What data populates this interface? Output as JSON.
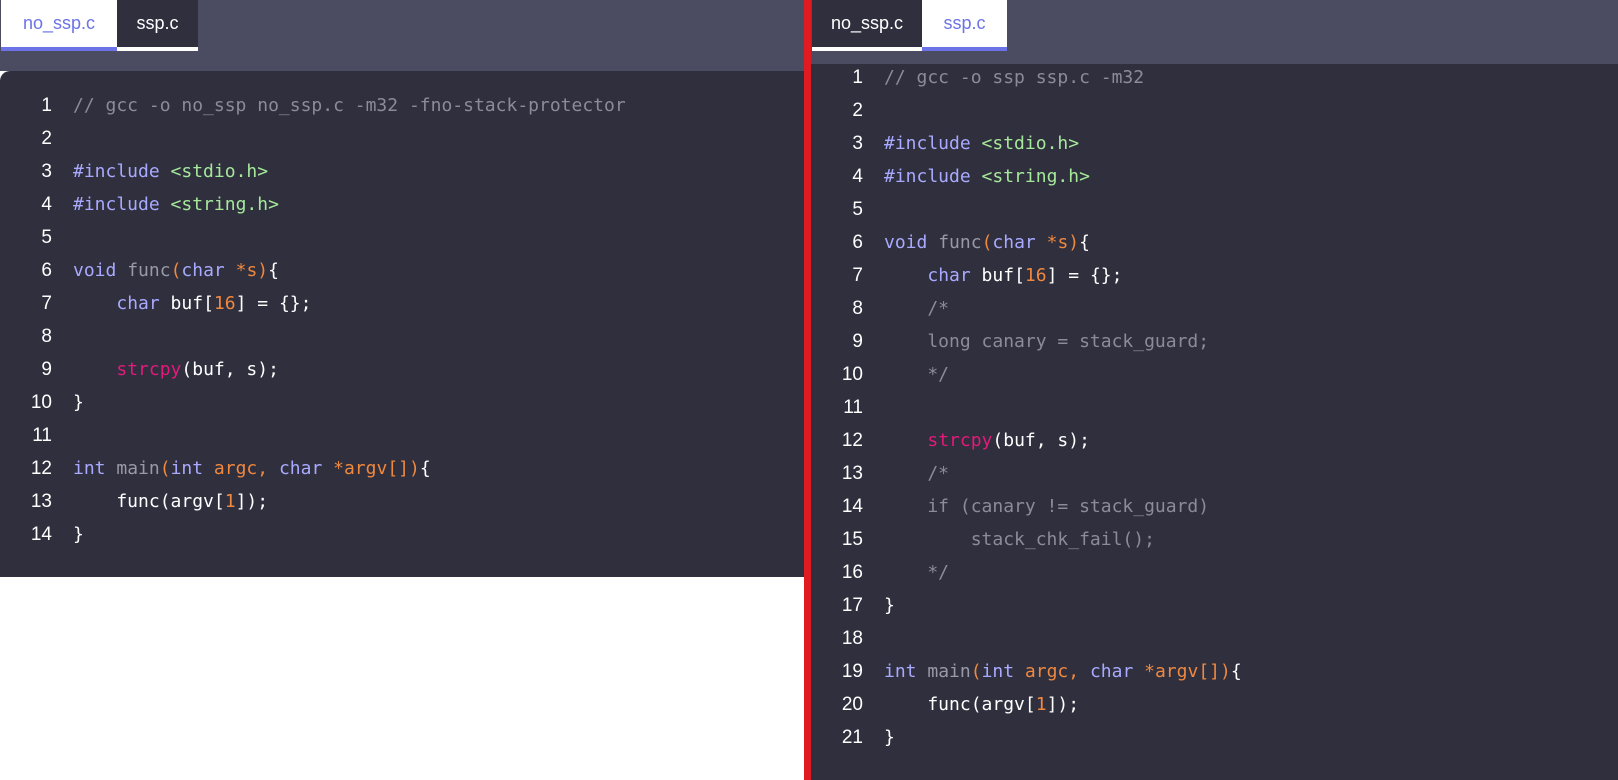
{
  "colors": {
    "tab_bar": "#4b4b62",
    "code_bg": "#2f2f3e",
    "active_tab_accent": "#6b73e6",
    "divider": "#e11b22",
    "comment": "#8c8c98",
    "keyword": "#a9aaff",
    "string": "#a6e89a",
    "number": "#f0883e",
    "call": "#e21a7a"
  },
  "left_pane": {
    "tabs": [
      {
        "label": "no_ssp.c",
        "active": true
      },
      {
        "label": "ssp.c",
        "active": false
      }
    ],
    "lines": [
      {
        "n": "1",
        "tokens": [
          [
            "// gcc -o no_ssp no_ssp.c -m32 -fno-stack-protector",
            "comment"
          ]
        ]
      },
      {
        "n": "2",
        "tokens": []
      },
      {
        "n": "3",
        "tokens": [
          [
            "#include",
            "kw"
          ],
          [
            " ",
            "text"
          ],
          [
            "<stdio.h>",
            "str"
          ]
        ]
      },
      {
        "n": "4",
        "tokens": [
          [
            "#include",
            "kw"
          ],
          [
            " ",
            "text"
          ],
          [
            "<string.h>",
            "str"
          ]
        ]
      },
      {
        "n": "5",
        "tokens": []
      },
      {
        "n": "6",
        "tokens": [
          [
            "void",
            "kw"
          ],
          [
            " ",
            "text"
          ],
          [
            "func",
            "fn"
          ],
          [
            "(",
            "paren"
          ],
          [
            "char",
            "kw"
          ],
          [
            " *s",
            "paren"
          ],
          [
            ")",
            "paren"
          ],
          [
            "{",
            "text"
          ]
        ]
      },
      {
        "n": "7",
        "tokens": [
          [
            "    ",
            "text"
          ],
          [
            "char",
            "kw"
          ],
          [
            " buf[",
            "text"
          ],
          [
            "16",
            "num"
          ],
          [
            "] = {};",
            "text"
          ]
        ]
      },
      {
        "n": "8",
        "tokens": []
      },
      {
        "n": "9",
        "tokens": [
          [
            "    ",
            "text"
          ],
          [
            "strcpy",
            "call"
          ],
          [
            "(buf, s);",
            "text"
          ]
        ]
      },
      {
        "n": "10",
        "tokens": [
          [
            "}",
            "text"
          ]
        ]
      },
      {
        "n": "11",
        "tokens": []
      },
      {
        "n": "12",
        "tokens": [
          [
            "int",
            "kw"
          ],
          [
            " ",
            "text"
          ],
          [
            "main",
            "fn"
          ],
          [
            "(",
            "paren"
          ],
          [
            "int",
            "kw"
          ],
          [
            " argc, ",
            "paren"
          ],
          [
            "char",
            "kw"
          ],
          [
            " *argv[]",
            "paren"
          ],
          [
            ")",
            "paren"
          ],
          [
            "{",
            "text"
          ]
        ]
      },
      {
        "n": "13",
        "tokens": [
          [
            "    func(argv[",
            "text"
          ],
          [
            "1",
            "num"
          ],
          [
            "]);",
            "text"
          ]
        ]
      },
      {
        "n": "14",
        "tokens": [
          [
            "}",
            "text"
          ]
        ]
      }
    ]
  },
  "right_pane": {
    "tabs": [
      {
        "label": "no_ssp.c",
        "active": false
      },
      {
        "label": "ssp.c",
        "active": true
      }
    ],
    "lines": [
      {
        "n": "1",
        "tokens": [
          [
            "// gcc -o ssp ssp.c -m32",
            "comment"
          ]
        ]
      },
      {
        "n": "2",
        "tokens": []
      },
      {
        "n": "3",
        "tokens": [
          [
            "#include",
            "kw"
          ],
          [
            " ",
            "text"
          ],
          [
            "<stdio.h>",
            "str"
          ]
        ]
      },
      {
        "n": "4",
        "tokens": [
          [
            "#include",
            "kw"
          ],
          [
            " ",
            "text"
          ],
          [
            "<string.h>",
            "str"
          ]
        ]
      },
      {
        "n": "5",
        "tokens": []
      },
      {
        "n": "6",
        "tokens": [
          [
            "void",
            "kw"
          ],
          [
            " ",
            "text"
          ],
          [
            "func",
            "fn"
          ],
          [
            "(",
            "paren"
          ],
          [
            "char",
            "kw"
          ],
          [
            " *s",
            "paren"
          ],
          [
            ")",
            "paren"
          ],
          [
            "{",
            "text"
          ]
        ]
      },
      {
        "n": "7",
        "tokens": [
          [
            "    ",
            "text"
          ],
          [
            "char",
            "kw"
          ],
          [
            " buf[",
            "text"
          ],
          [
            "16",
            "num"
          ],
          [
            "] = {};",
            "text"
          ]
        ]
      },
      {
        "n": "8",
        "tokens": [
          [
            "    /*",
            "comment"
          ]
        ]
      },
      {
        "n": "9",
        "tokens": [
          [
            "    long canary = stack_guard;",
            "comment"
          ]
        ]
      },
      {
        "n": "10",
        "tokens": [
          [
            "    */",
            "comment"
          ]
        ]
      },
      {
        "n": "11",
        "tokens": []
      },
      {
        "n": "12",
        "tokens": [
          [
            "    ",
            "text"
          ],
          [
            "strcpy",
            "call"
          ],
          [
            "(buf, s);",
            "text"
          ]
        ]
      },
      {
        "n": "13",
        "tokens": [
          [
            "    /*",
            "comment"
          ]
        ]
      },
      {
        "n": "14",
        "tokens": [
          [
            "    if (canary != stack_guard)",
            "comment"
          ]
        ]
      },
      {
        "n": "15",
        "tokens": [
          [
            "        stack_chk_fail();",
            "comment"
          ]
        ]
      },
      {
        "n": "16",
        "tokens": [
          [
            "    */",
            "comment"
          ]
        ]
      },
      {
        "n": "17",
        "tokens": [
          [
            "}",
            "text"
          ]
        ]
      },
      {
        "n": "18",
        "tokens": []
      },
      {
        "n": "19",
        "tokens": [
          [
            "int",
            "kw"
          ],
          [
            " ",
            "text"
          ],
          [
            "main",
            "fn"
          ],
          [
            "(",
            "paren"
          ],
          [
            "int",
            "kw"
          ],
          [
            " argc, ",
            "paren"
          ],
          [
            "char",
            "kw"
          ],
          [
            " *argv[]",
            "paren"
          ],
          [
            ")",
            "paren"
          ],
          [
            "{",
            "text"
          ]
        ]
      },
      {
        "n": "20",
        "tokens": [
          [
            "    func(argv[",
            "text"
          ],
          [
            "1",
            "num"
          ],
          [
            "]);",
            "text"
          ]
        ]
      },
      {
        "n": "21",
        "tokens": [
          [
            "}",
            "text"
          ]
        ]
      }
    ]
  }
}
